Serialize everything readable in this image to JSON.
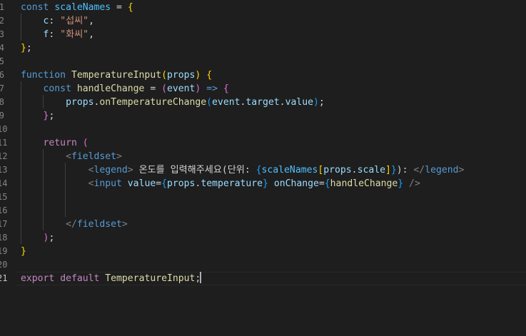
{
  "editor": {
    "active_line": 21,
    "line_numbers": [
      "1",
      "2",
      "3",
      "4",
      "5",
      "6",
      "7",
      "8",
      "9",
      "10",
      "11",
      "12",
      "13",
      "14",
      "15",
      "16",
      "17",
      "18",
      "19",
      "20",
      "21"
    ],
    "lines": [
      [
        {
          "t": "const ",
          "c": "kw"
        },
        {
          "t": "scaleNames",
          "c": "cn"
        },
        {
          "t": " = ",
          "c": "pl"
        },
        {
          "t": "{",
          "c": "b1"
        }
      ],
      [
        {
          "t": "    c",
          "c": "vr"
        },
        {
          "t": ": ",
          "c": "pl"
        },
        {
          "t": "\"섭씨\"",
          "c": "str"
        },
        {
          "t": ",",
          "c": "pl"
        }
      ],
      [
        {
          "t": "    f",
          "c": "vr"
        },
        {
          "t": ": ",
          "c": "pl"
        },
        {
          "t": "\"화씨\"",
          "c": "str"
        },
        {
          "t": ",",
          "c": "pl"
        }
      ],
      [
        {
          "t": "}",
          "c": "b1"
        },
        {
          "t": ";",
          "c": "pl"
        }
      ],
      [],
      [
        {
          "t": "function ",
          "c": "kw"
        },
        {
          "t": "TemperatureInput",
          "c": "fn"
        },
        {
          "t": "(",
          "c": "b1"
        },
        {
          "t": "props",
          "c": "vr"
        },
        {
          "t": ")",
          "c": "b1"
        },
        {
          "t": " ",
          "c": "pl"
        },
        {
          "t": "{",
          "c": "b1"
        }
      ],
      [
        {
          "t": "    const ",
          "c": "kw"
        },
        {
          "t": "handleChange",
          "c": "fn"
        },
        {
          "t": " = ",
          "c": "pl"
        },
        {
          "t": "(",
          "c": "b2"
        },
        {
          "t": "event",
          "c": "vr"
        },
        {
          "t": ")",
          "c": "b2"
        },
        {
          "t": " => ",
          "c": "kw"
        },
        {
          "t": "{",
          "c": "b2"
        }
      ],
      [
        {
          "t": "        props",
          "c": "vr"
        },
        {
          "t": ".",
          "c": "pl"
        },
        {
          "t": "onTemperatureChange",
          "c": "fn"
        },
        {
          "t": "(",
          "c": "b3"
        },
        {
          "t": "event",
          "c": "vr"
        },
        {
          "t": ".",
          "c": "pl"
        },
        {
          "t": "target",
          "c": "vr"
        },
        {
          "t": ".",
          "c": "pl"
        },
        {
          "t": "value",
          "c": "vr"
        },
        {
          "t": ")",
          "c": "b3"
        },
        {
          "t": ";",
          "c": "pl"
        }
      ],
      [
        {
          "t": "    ",
          "c": "pl"
        },
        {
          "t": "}",
          "c": "b2"
        },
        {
          "t": ";",
          "c": "pl"
        }
      ],
      [],
      [
        {
          "t": "    return ",
          "c": "kw2"
        },
        {
          "t": "(",
          "c": "b2"
        }
      ],
      [
        {
          "t": "        <",
          "c": "tagb"
        },
        {
          "t": "fieldset",
          "c": "tag"
        },
        {
          "t": ">",
          "c": "tagb"
        }
      ],
      [
        {
          "t": "            <",
          "c": "tagb"
        },
        {
          "t": "legend",
          "c": "tag"
        },
        {
          "t": ">",
          "c": "tagb"
        },
        {
          "t": " 온도를 입력해주세요(단위: ",
          "c": "pl"
        },
        {
          "t": "{",
          "c": "b3"
        },
        {
          "t": "scaleNames",
          "c": "cn"
        },
        {
          "t": "[",
          "c": "b1"
        },
        {
          "t": "props",
          "c": "vr"
        },
        {
          "t": ".",
          "c": "pl"
        },
        {
          "t": "scale",
          "c": "vr"
        },
        {
          "t": "]",
          "c": "b1"
        },
        {
          "t": "}",
          "c": "b3"
        },
        {
          "t": "): ",
          "c": "pl"
        },
        {
          "t": "</",
          "c": "tagb"
        },
        {
          "t": "legend",
          "c": "tag"
        },
        {
          "t": ">",
          "c": "tagb"
        }
      ],
      [
        {
          "t": "            <",
          "c": "tagb"
        },
        {
          "t": "input",
          "c": "tag"
        },
        {
          "t": " ",
          "c": "pl"
        },
        {
          "t": "value",
          "c": "vr"
        },
        {
          "t": "=",
          "c": "pl"
        },
        {
          "t": "{",
          "c": "b3"
        },
        {
          "t": "props",
          "c": "vr"
        },
        {
          "t": ".",
          "c": "pl"
        },
        {
          "t": "temperature",
          "c": "vr"
        },
        {
          "t": "}",
          "c": "b3"
        },
        {
          "t": " ",
          "c": "pl"
        },
        {
          "t": "onChange",
          "c": "vr"
        },
        {
          "t": "=",
          "c": "pl"
        },
        {
          "t": "{",
          "c": "b3"
        },
        {
          "t": "handleChange",
          "c": "fn"
        },
        {
          "t": "}",
          "c": "b3"
        },
        {
          "t": " />",
          "c": "tagb"
        }
      ],
      [],
      [],
      [
        {
          "t": "        </",
          "c": "tagb"
        },
        {
          "t": "fieldset",
          "c": "tag"
        },
        {
          "t": ">",
          "c": "tagb"
        }
      ],
      [
        {
          "t": "    ",
          "c": "pl"
        },
        {
          "t": ")",
          "c": "b2"
        },
        {
          "t": ";",
          "c": "pl"
        }
      ],
      [
        {
          "t": "}",
          "c": "b1"
        }
      ],
      [],
      [
        {
          "t": "export ",
          "c": "kw2"
        },
        {
          "t": "default ",
          "c": "kw2"
        },
        {
          "t": "TemperatureInput",
          "c": "fn"
        },
        {
          "t": ";",
          "c": "pl"
        }
      ]
    ]
  }
}
